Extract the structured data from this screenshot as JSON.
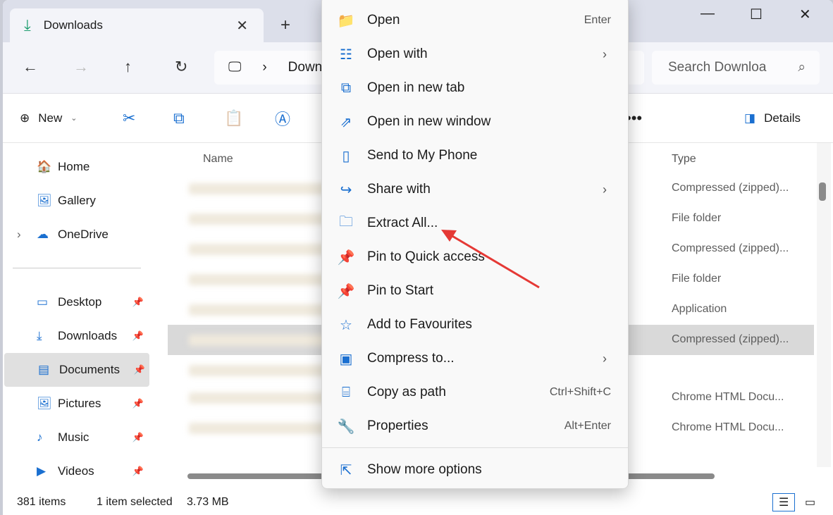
{
  "tab": {
    "title": "Downloads"
  },
  "address": {
    "crumb": "Downloads"
  },
  "search": {
    "placeholder": "Search Downloa"
  },
  "toolbar": {
    "new": "New",
    "details": "Details"
  },
  "sidebar": {
    "items": [
      {
        "label": "Home",
        "icon": "home-icon",
        "glyph": "🏠",
        "pin": false
      },
      {
        "label": "Gallery",
        "icon": "gallery-icon",
        "glyph": "🖼",
        "pin": false
      },
      {
        "label": "OneDrive",
        "icon": "cloud-icon",
        "glyph": "☁",
        "pin": false,
        "expand": true
      },
      {
        "label": "Desktop",
        "icon": "desktop-icon",
        "glyph": "▭",
        "pin": true
      },
      {
        "label": "Downloads",
        "icon": "download-icon",
        "glyph": "⤓",
        "pin": true
      },
      {
        "label": "Documents",
        "icon": "document-icon",
        "glyph": "▤",
        "pin": true,
        "selected": true
      },
      {
        "label": "Pictures",
        "icon": "pictures-icon",
        "glyph": "🖼",
        "pin": true
      },
      {
        "label": "Music",
        "icon": "music-icon",
        "glyph": "♪",
        "pin": true
      },
      {
        "label": "Videos",
        "icon": "video-icon",
        "glyph": "▶",
        "pin": true
      }
    ]
  },
  "list": {
    "columns": [
      "Name",
      "Type"
    ],
    "rows": [
      {
        "type": "Compressed (zipped)..."
      },
      {
        "type": "File folder"
      },
      {
        "type": "Compressed (zipped)..."
      },
      {
        "type": "File folder"
      },
      {
        "type": "Application"
      },
      {
        "type": "Compressed (zipped)...",
        "selected": true
      },
      {
        "type": ""
      },
      {
        "type": "Chrome HTML Docu..."
      },
      {
        "type": "Chrome HTML Docu..."
      }
    ]
  },
  "status": {
    "count": "381 items",
    "selected": "1 item selected",
    "size": "3.73 MB"
  },
  "menu": {
    "items": [
      {
        "label": "Open",
        "shortcut": "Enter",
        "icon": "folder-icon",
        "glyph": "📁"
      },
      {
        "label": "Open with",
        "icon": "open-with-icon",
        "glyph": "☷",
        "sub": true
      },
      {
        "label": "Open in new tab",
        "icon": "new-tab-icon",
        "glyph": "⧉"
      },
      {
        "label": "Open in new window",
        "icon": "new-window-icon",
        "glyph": "⇗"
      },
      {
        "label": "Send to My Phone",
        "icon": "phone-icon",
        "glyph": "▯"
      },
      {
        "label": "Share with",
        "icon": "share-icon",
        "glyph": "↪",
        "sub": true
      },
      {
        "label": "Extract All...",
        "icon": "extract-icon",
        "glyph": "🗀"
      },
      {
        "label": "Pin to Quick access",
        "icon": "pin-icon",
        "glyph": "📌"
      },
      {
        "label": "Pin to Start",
        "icon": "pin-start-icon",
        "glyph": "📌"
      },
      {
        "label": "Add to Favourites",
        "icon": "star-icon",
        "glyph": "☆"
      },
      {
        "label": "Compress to...",
        "icon": "compress-icon",
        "glyph": "▣",
        "sub": true
      },
      {
        "label": "Copy as path",
        "shortcut": "Ctrl+Shift+C",
        "icon": "copy-path-icon",
        "glyph": "⌸"
      },
      {
        "label": "Properties",
        "shortcut": "Alt+Enter",
        "icon": "wrench-icon",
        "glyph": "🔧"
      }
    ],
    "more": {
      "label": "Show more options",
      "icon": "more-options-icon",
      "glyph": "⇱"
    }
  },
  "annotation": {
    "arrow_color": "#e53935"
  }
}
